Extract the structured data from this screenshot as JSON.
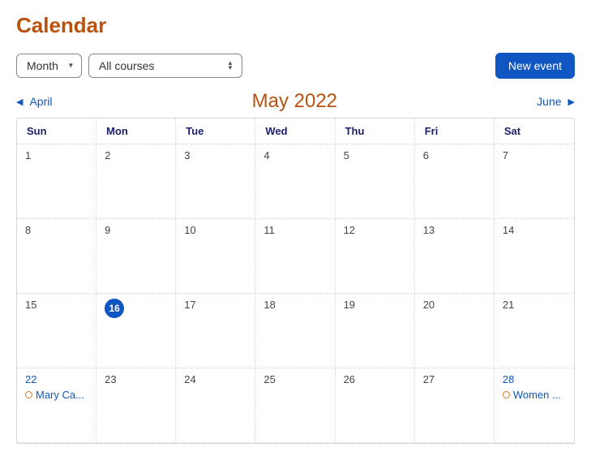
{
  "title": "Calendar",
  "toolbar": {
    "view_select": "Month",
    "course_select": "All courses",
    "new_event": "New event"
  },
  "nav": {
    "prev": "April",
    "current": "May 2022",
    "next": "June"
  },
  "dow": [
    "Sun",
    "Mon",
    "Tue",
    "Wed",
    "Thu",
    "Fri",
    "Sat"
  ],
  "weeks": [
    [
      {
        "n": "1"
      },
      {
        "n": "2"
      },
      {
        "n": "3"
      },
      {
        "n": "4"
      },
      {
        "n": "5"
      },
      {
        "n": "6"
      },
      {
        "n": "7"
      }
    ],
    [
      {
        "n": "8"
      },
      {
        "n": "9"
      },
      {
        "n": "10"
      },
      {
        "n": "11"
      },
      {
        "n": "12"
      },
      {
        "n": "13"
      },
      {
        "n": "14"
      }
    ],
    [
      {
        "n": "15"
      },
      {
        "n": "16",
        "today": true
      },
      {
        "n": "17"
      },
      {
        "n": "18"
      },
      {
        "n": "19"
      },
      {
        "n": "20"
      },
      {
        "n": "21"
      }
    ],
    [
      {
        "n": "22",
        "link": true,
        "event": "Mary Ca..."
      },
      {
        "n": "23"
      },
      {
        "n": "24"
      },
      {
        "n": "25"
      },
      {
        "n": "26"
      },
      {
        "n": "27"
      },
      {
        "n": "28",
        "link": true,
        "event": "Women ..."
      }
    ]
  ]
}
